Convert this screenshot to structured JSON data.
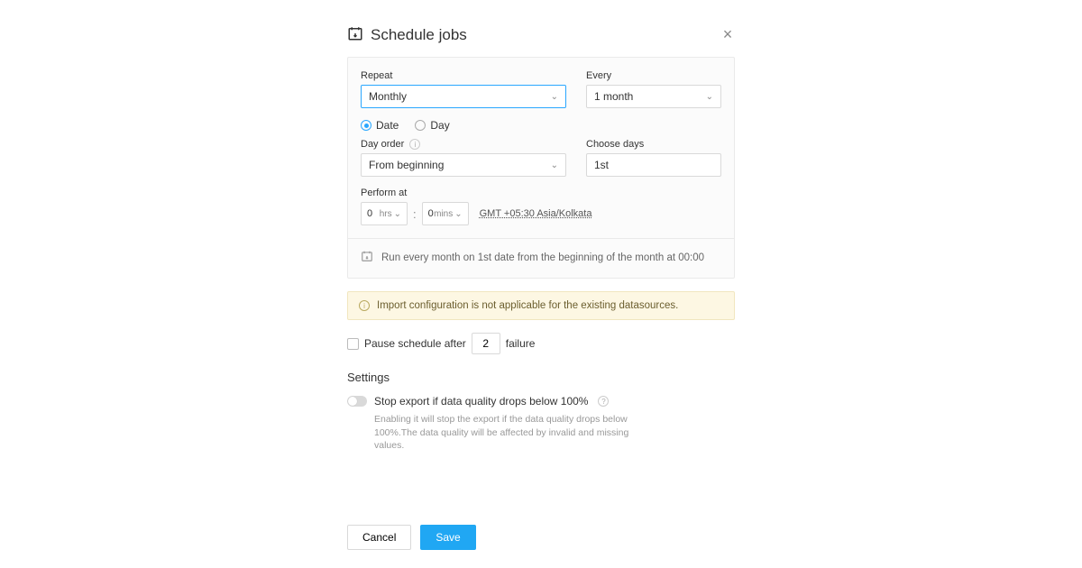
{
  "header": {
    "title": "Schedule jobs"
  },
  "repeat": {
    "label": "Repeat",
    "value": "Monthly"
  },
  "every": {
    "label": "Every",
    "value": "1 month"
  },
  "mode": {
    "date_label": "Date",
    "day_label": "Day",
    "selected": "date"
  },
  "dayorder": {
    "label": "Day order",
    "value": "From beginning"
  },
  "choosedays": {
    "label": "Choose days",
    "value": "1st"
  },
  "perform": {
    "label": "Perform at",
    "hours": "0",
    "hours_unit": "hrs",
    "mins": "0",
    "mins_unit": "mins",
    "timezone": "GMT +05:30 Asia/Kolkata"
  },
  "summary": "Run every month on 1st date from the beginning of the month at 00:00",
  "notice": "Import configuration is not applicable for the existing datasources.",
  "pause": {
    "prefix": "Pause schedule after",
    "value": "2",
    "suffix": "failure"
  },
  "settings": {
    "title": "Settings",
    "stop_export_label": "Stop export if data quality drops below 100%",
    "help": "Enabling it will stop the export if the data quality drops below 100%.The data quality will be affected by invalid and missing values."
  },
  "footer": {
    "cancel": "Cancel",
    "save": "Save"
  }
}
